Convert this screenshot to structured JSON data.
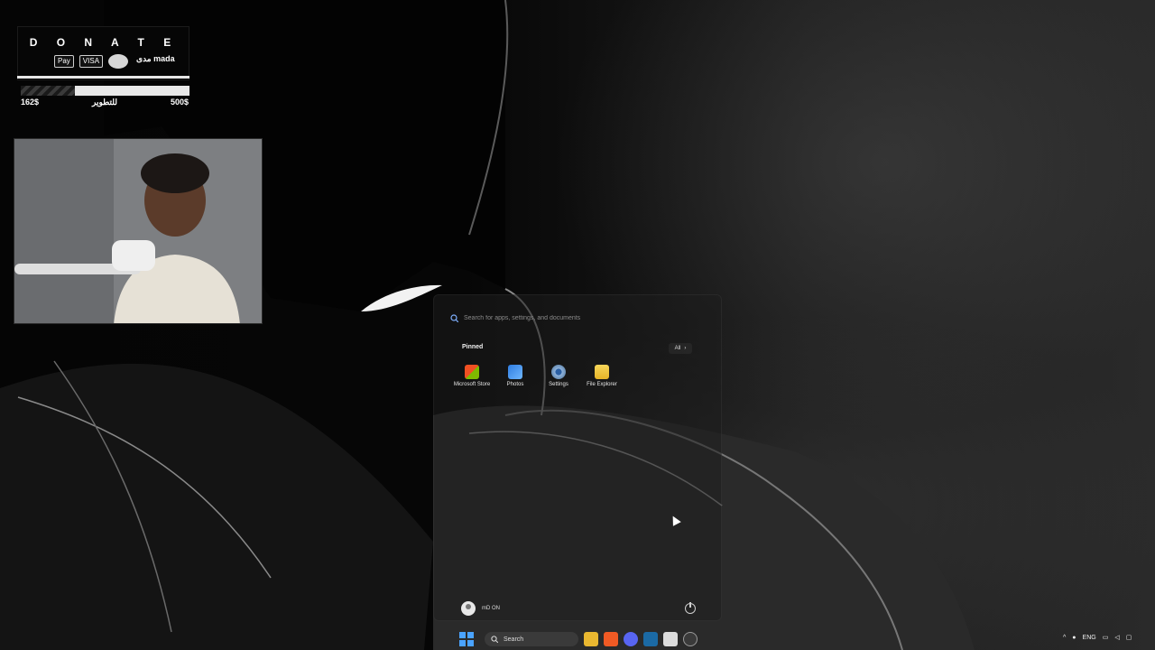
{
  "donate": {
    "title": "D O N A T E",
    "payments": [
      "Pay",
      "VISA",
      "mastercard",
      "مدى mada"
    ],
    "goal": {
      "raised_label": "162$",
      "target_label": "500$",
      "caption": "للتطوير",
      "progress_fraction": 0.32
    }
  },
  "start_menu": {
    "search_placeholder": "Search for apps, settings, and documents",
    "pinned_label": "Pinned",
    "all_label": "All",
    "apps": [
      {
        "label": "Microsoft Store",
        "icon": "microsoft-store-icon",
        "color": "#f25022"
      },
      {
        "label": "Photos",
        "icon": "photos-icon",
        "color": "#2f7de1"
      },
      {
        "label": "Settings",
        "icon": "gear-icon",
        "color": "#6b8fb5"
      },
      {
        "label": "File Explorer",
        "icon": "folder-icon",
        "color": "#f3c336"
      }
    ],
    "user_name": "mD ON"
  },
  "taskbar": {
    "search_label": "Search",
    "tray": {
      "language": "ENG"
    },
    "apps": [
      "file-explorer-icon",
      "brave-icon",
      "discord-icon",
      "steam-icon",
      "calendar-icon",
      "obs-icon"
    ]
  },
  "colors": {
    "accent": "#4aa3ff"
  }
}
